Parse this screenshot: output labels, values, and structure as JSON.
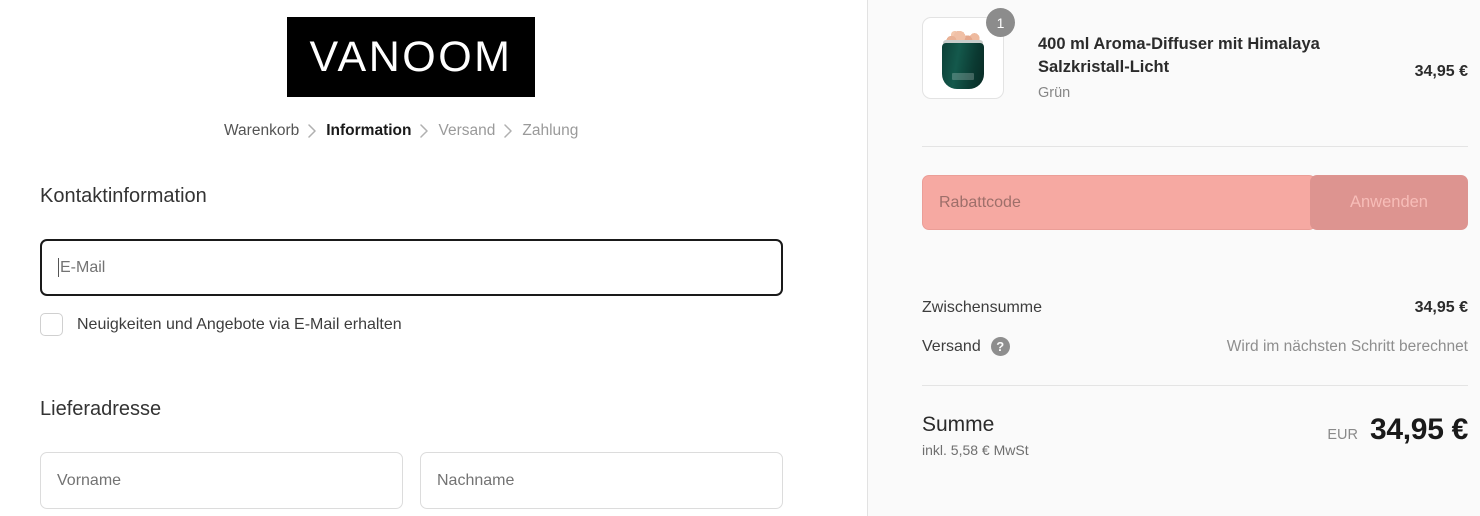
{
  "brand": {
    "logo_text": "VANOOM"
  },
  "breadcrumb": {
    "items": [
      {
        "label": "Warenkorb",
        "state": "done"
      },
      {
        "label": "Information",
        "state": "active"
      },
      {
        "label": "Versand",
        "state": "muted"
      },
      {
        "label": "Zahlung",
        "state": "muted"
      }
    ]
  },
  "contact": {
    "title": "Kontaktinformation",
    "email_placeholder": "E-Mail",
    "email_value": "",
    "newsletter_label": "Neuigkeiten und Angebote via E-Mail erhalten",
    "newsletter_checked": false
  },
  "delivery": {
    "title": "Lieferadresse",
    "first_name_placeholder": "Vorname",
    "first_name_value": "",
    "last_name_placeholder": "Nachname",
    "last_name_value": ""
  },
  "summary": {
    "item": {
      "name": "400 ml Aroma-Diffuser mit Himalaya Salzkristall-Licht",
      "variant": "Grün",
      "price": "34,95 €",
      "quantity": "1"
    },
    "discount": {
      "placeholder": "Rabattcode",
      "value": "",
      "apply_label": "Anwenden"
    },
    "subtotal_label": "Zwischensumme",
    "subtotal_value": "34,95 €",
    "shipping_label": "Versand",
    "shipping_help_icon": "?",
    "shipping_value": "Wird im nächsten Schritt berechnet",
    "total_label": "Summe",
    "total_tax_note": "inkl. 5,58 € MwSt",
    "total_currency": "EUR",
    "total_value": "34,95 €"
  },
  "colors": {
    "logo_bg": "#000000",
    "panel_bg": "#fafafa",
    "discount_highlight": "#f6a9a2",
    "apply_button": "#dd9490",
    "focus_border": "#1a1a1a"
  }
}
